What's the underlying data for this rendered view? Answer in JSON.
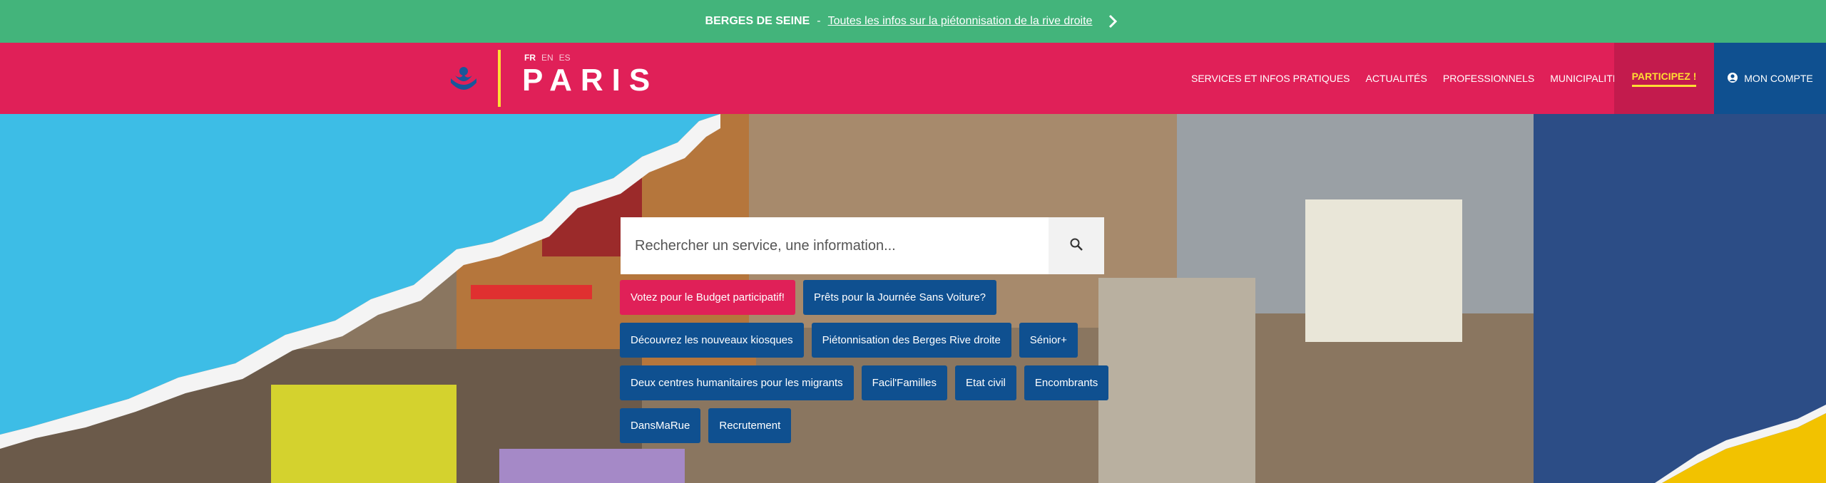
{
  "banner": {
    "bold": "BERGES DE SEINE",
    "sep": "-",
    "link": "Toutes les infos sur la piétonnisation de la rive droite"
  },
  "header": {
    "langs": [
      "FR",
      "EN",
      "ES"
    ],
    "wordmark": "PARIS",
    "nav": [
      "SERVICES ET INFOS PRATIQUES",
      "ACTUALITÉS",
      "PROFESSIONNELS",
      "MUNICIPALITÉ"
    ],
    "participez": "PARTICIPEZ !",
    "compte": "MON COMPTE"
  },
  "search": {
    "placeholder": "Rechercher un service, une information..."
  },
  "tags": {
    "row1": [
      "Votez pour le Budget participatif!",
      "Prêts pour la Journée Sans Voiture?"
    ],
    "row2": [
      "Découvrez les nouveaux kiosques",
      "Piétonnisation des Berges Rive droite",
      "Sénior+"
    ],
    "row3": [
      "Deux centres humanitaires pour les migrants",
      "Facil'Familles",
      "Etat civil",
      "Encombrants"
    ],
    "row4": [
      "DansMaRue",
      "Recrutement"
    ]
  },
  "colors": {
    "banner": "#43b47b",
    "header": "#e02058",
    "participez_bg": "#c31b4d",
    "compte_bg": "#0f5090",
    "tag_blue": "#0f5090",
    "tag_pink": "#e02058",
    "accent_yellow": "#ffdd33",
    "sky_blue": "#3dbde6"
  },
  "icons": {
    "search": "search-icon",
    "user": "user-icon",
    "chevron": "chevron-right-icon",
    "emblem": "paris-emblem-icon"
  }
}
